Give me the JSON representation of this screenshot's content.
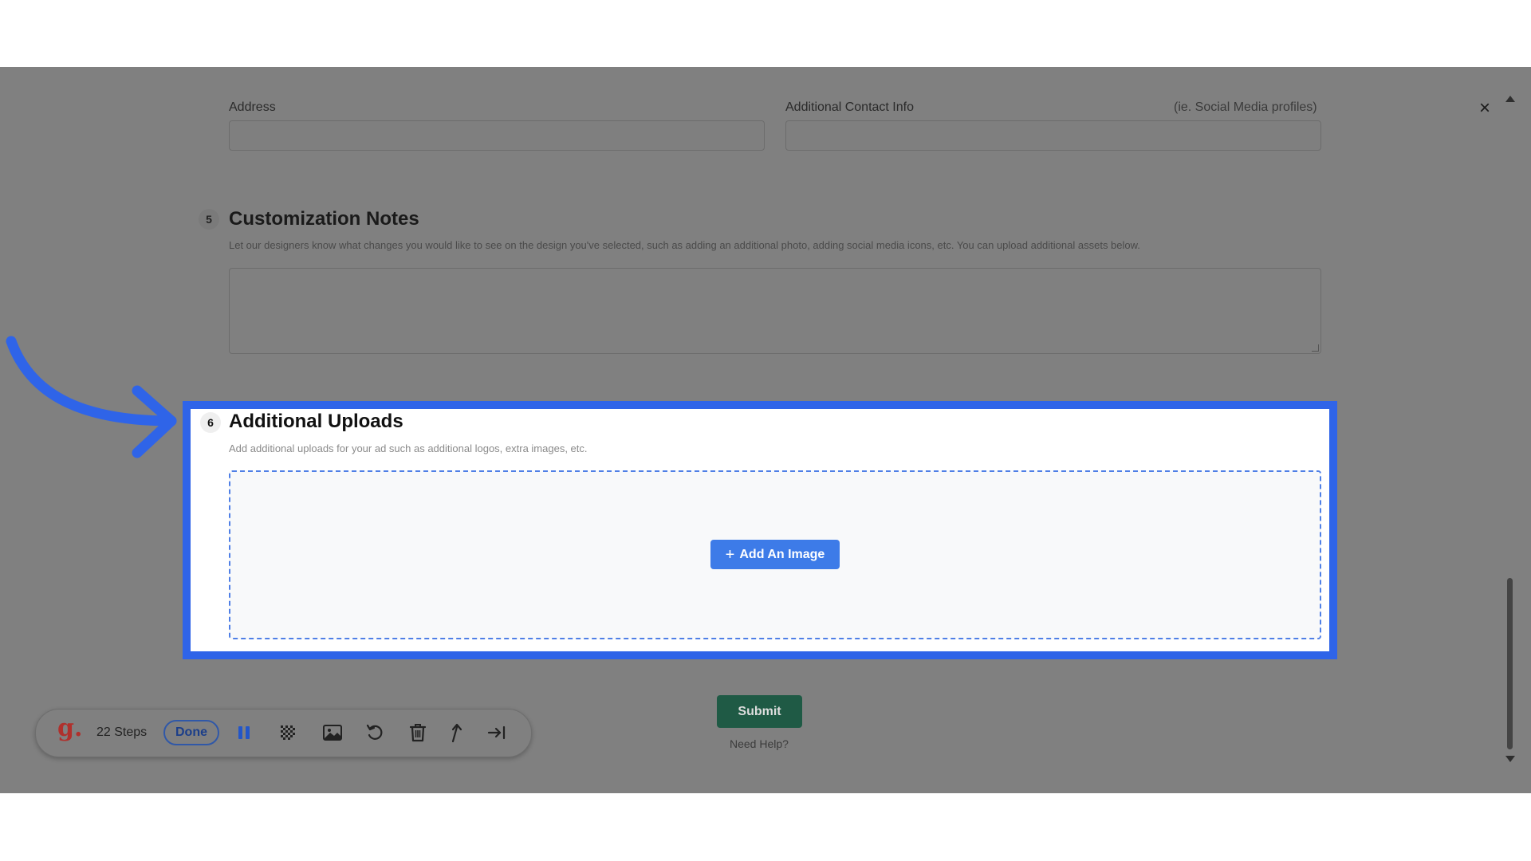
{
  "form": {
    "address_label": "Address",
    "contact_label": "Additional Contact Info",
    "contact_hint": "(ie. Social Media profiles)"
  },
  "sections": {
    "customization": {
      "number": "5",
      "title": "Customization Notes",
      "description": "Let our designers know what changes you would like to see on the design you've selected, such as adding an additional photo, adding social media icons, etc. You can upload additional assets below."
    },
    "uploads": {
      "number": "6",
      "title": "Additional Uploads",
      "description": "Add additional uploads for your ad such as additional logos, extra images, etc.",
      "add_button": "Add An Image"
    }
  },
  "actions": {
    "submit": "Submit",
    "help": "Need Help?",
    "close": "×"
  },
  "toolbar": {
    "logo": "g.",
    "steps": "22 Steps",
    "done": "Done",
    "icons": [
      "pause-icon",
      "blur-icon",
      "image-icon",
      "undo-icon",
      "trash-icon",
      "upload-icon",
      "skip-icon"
    ]
  },
  "colors": {
    "highlight": "#2f64e8",
    "add_button": "#3d7be8",
    "submit": "#1f5a45",
    "overlay": "#808080",
    "brand": "#b0302c"
  }
}
